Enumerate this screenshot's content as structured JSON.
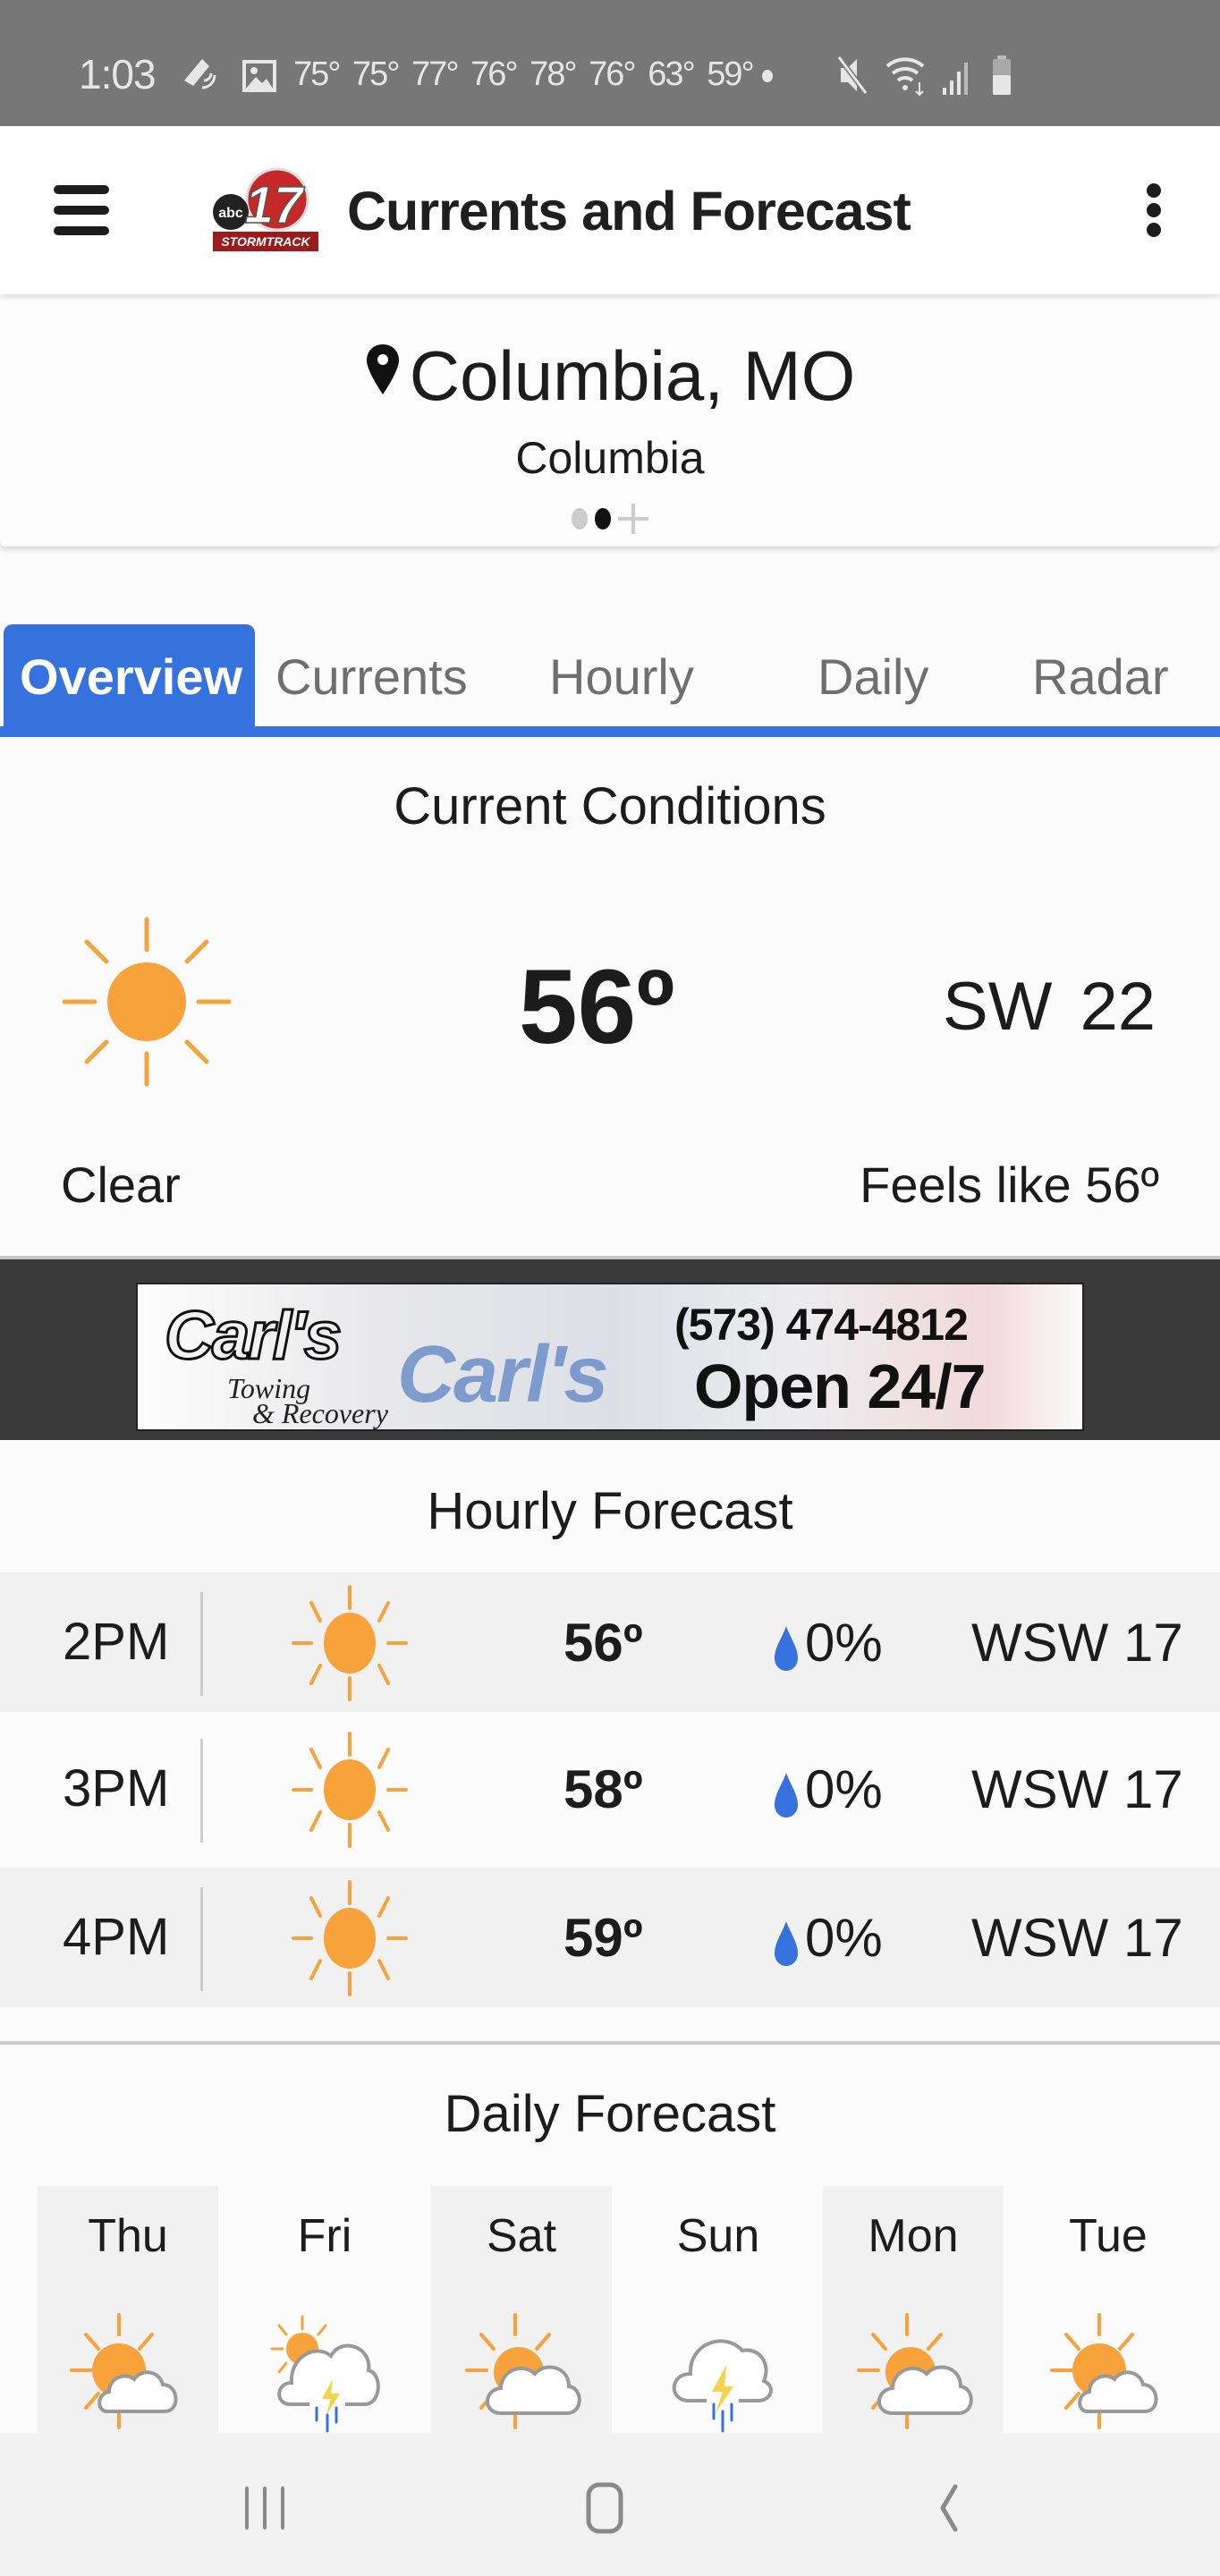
{
  "status_bar": {
    "time": "1:03",
    "temps": [
      "75°",
      "75°",
      "77°",
      "76°",
      "78°",
      "76°",
      "63°",
      "59°"
    ],
    "icons": [
      "navigation-icon",
      "gallery-icon",
      "dot-icon",
      "mute-icon",
      "wifi-icon",
      "signal-icon",
      "battery-icon"
    ]
  },
  "app_bar": {
    "title": "Currents and Forecast",
    "logo_text": "abc 17 STORMTRACK",
    "menu_icon": "hamburger-menu-icon",
    "more_icon": "more-vertical-icon"
  },
  "location": {
    "name": "Columbia, MO",
    "sub": "Columbia",
    "pages": 2,
    "active_page": 2
  },
  "tabs": [
    {
      "label": "Overview",
      "active": true
    },
    {
      "label": "Currents",
      "active": false
    },
    {
      "label": "Hourly",
      "active": false
    },
    {
      "label": "Daily",
      "active": false
    },
    {
      "label": "Radar",
      "active": false
    }
  ],
  "current_conditions": {
    "title": "Current Conditions",
    "icon": "sunny-icon",
    "temperature": "56º",
    "wind": "SW  22",
    "condition": "Clear",
    "feels_like": "Feels like 56º"
  },
  "ad": {
    "brand": "Carl's",
    "tagline_1": "Towing",
    "tagline_2": "& Recovery",
    "phone": "(573) 474-4812",
    "hours": "Open 24/7"
  },
  "hourly": {
    "title": "Hourly Forecast",
    "rows": [
      {
        "time": "2PM",
        "icon": "sunny-icon",
        "temp": "56º",
        "precip": "0%",
        "wind": "WSW 17"
      },
      {
        "time": "3PM",
        "icon": "sunny-icon",
        "temp": "58º",
        "precip": "0%",
        "wind": "WSW 17"
      },
      {
        "time": "4PM",
        "icon": "sunny-icon",
        "temp": "59º",
        "precip": "0%",
        "wind": "WSW 17"
      }
    ]
  },
  "daily": {
    "title": "Daily Forecast",
    "days": [
      {
        "name": "Thu",
        "icon": "partly-cloudy-icon"
      },
      {
        "name": "Fri",
        "icon": "sun-thunderstorm-icon"
      },
      {
        "name": "Sat",
        "icon": "partly-cloudy-icon"
      },
      {
        "name": "Sun",
        "icon": "thunderstorm-icon"
      },
      {
        "name": "Mon",
        "icon": "partly-cloudy-icon"
      },
      {
        "name": "Tue",
        "icon": "partly-cloudy-icon"
      }
    ]
  },
  "colors": {
    "accent": "#3572de",
    "sun": "#f7a23a",
    "drop": "#3572de",
    "status_bar": "#777777",
    "ad_band": "#3a3a3a"
  },
  "nav_bar": {
    "buttons": [
      "recent-apps",
      "home",
      "back"
    ]
  }
}
